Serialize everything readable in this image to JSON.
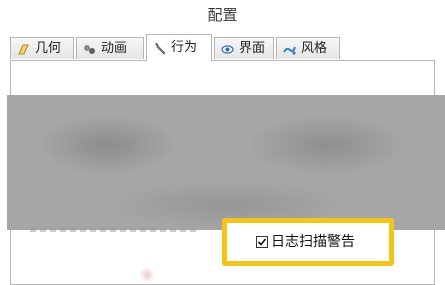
{
  "window": {
    "title": "配置"
  },
  "tabs": [
    {
      "label": "几何",
      "icon": "geometry-icon",
      "active": false
    },
    {
      "label": "动画",
      "icon": "animation-icon",
      "active": false
    },
    {
      "label": "行为",
      "icon": "wrench-icon",
      "active": true
    },
    {
      "label": "界面",
      "icon": "eye-icon",
      "active": false
    },
    {
      "label": "风格",
      "icon": "style-icon",
      "active": false
    }
  ],
  "behavior": {
    "log_scan_warning": {
      "label": "日志扫描警告",
      "checked": true
    }
  },
  "colors": {
    "highlight": "#f2c51b",
    "redacted": "#a6a6a6"
  }
}
